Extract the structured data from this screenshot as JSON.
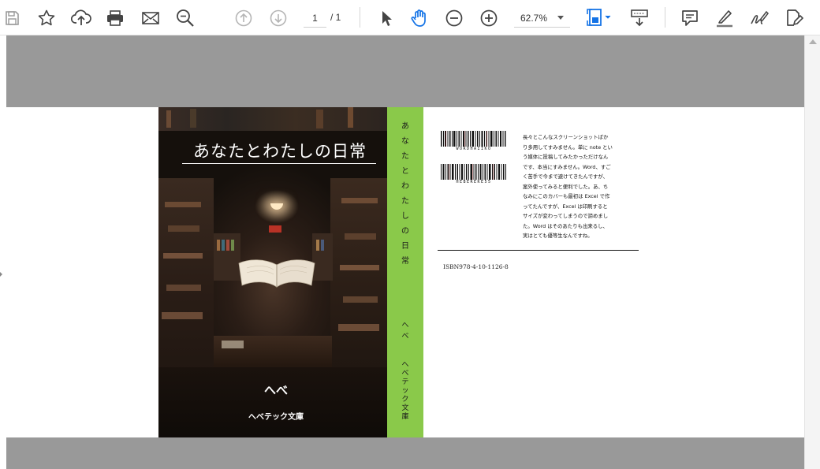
{
  "toolbar": {
    "icons": [
      "save-icon",
      "bookmark-star-icon",
      "upload-cloud-icon",
      "print-icon",
      "email-icon",
      "zoom-search-icon",
      "page-up-icon",
      "page-down-icon",
      "select-cursor-icon",
      "hand-tool-icon",
      "zoom-out-icon",
      "zoom-in-icon",
      "fit-page-icon",
      "scroll-mode-icon",
      "comment-icon",
      "highlight-icon",
      "sign-icon",
      "edit-pdf-icon"
    ],
    "current_page": "1",
    "page_total": "/ 1",
    "zoom": "62.7%",
    "accent_color": "#1473e6"
  },
  "book": {
    "title": "あなたとわたしの日常",
    "author": "へべ",
    "publisher": "へべテック文庫",
    "spine_title": [
      "あ",
      "な",
      "た",
      "と",
      "わ",
      "た",
      "し",
      "の",
      "日",
      "常"
    ],
    "spine_author": [
      "へ",
      "べ"
    ],
    "spine_publisher": [
      "へ",
      "べ",
      "テ",
      "ッ",
      "ク",
      "文",
      "庫"
    ],
    "spine_color": "#8ac94a",
    "barcode1_label": "WORDHAIIKO",
    "barcode2_label": "HEBEREKE55",
    "blurb": "長々とこんなスクリーンショットばか\nり多用してすみません。単に note とい\nう媒体に投稿してみたかっただけなん\nです、本当にすみません。Word、すご\nく苦手で今まで避けてきたんですが、\n案外使ってみると便利でした。あ、ち\nなみにこのカバーも最初は Excel で作\nってたんですが、Excel は印刷すると\nサイズが変わってしまうので諦めまし\nた。Word はそのあたりも出来るし、\n実はとても優等生なんですね。",
    "isbn": "ISBN978-4-10-1126-8"
  }
}
